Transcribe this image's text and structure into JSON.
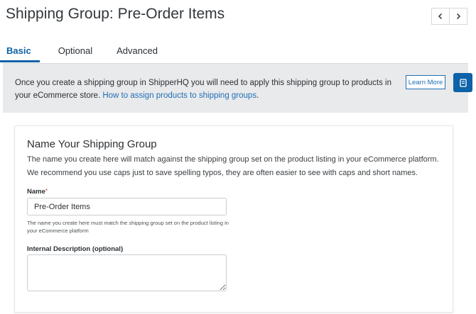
{
  "header": {
    "title": "Shipping Group: Pre-Order Items",
    "prev_icon": "chevron-left-icon",
    "next_icon": "chevron-right-icon"
  },
  "tabs": [
    {
      "label": "Basic",
      "active": true
    },
    {
      "label": "Optional",
      "active": false
    },
    {
      "label": "Advanced",
      "active": false
    }
  ],
  "banner": {
    "text": "Once you create a shipping group in ShipperHQ you will need to apply this shipping group to products in your eCommerce store.",
    "link_text": "How to assign products to shipping groups",
    "link_suffix": ".",
    "learn_more_label": "Learn More",
    "help_icon": "book-icon"
  },
  "card": {
    "title": "Name Your Shipping Group",
    "description": "The name you create here will match against the shipping group set on the product listing in your eCommerce platform. We recommend you use caps just to save spelling typos, they are often easier to see with caps and short names.",
    "name_field": {
      "label": "Name",
      "required_marker": "*",
      "value": "Pre-Order Items",
      "help": "The name you create here must match the shipping group set on the product listing in your eCommerce platform"
    },
    "internal_description": {
      "label": "Internal Description (optional)",
      "value": ""
    }
  },
  "colors": {
    "accent": "#0d62a8",
    "link": "#1f6fb5",
    "banner_bg": "#e9eaec"
  }
}
